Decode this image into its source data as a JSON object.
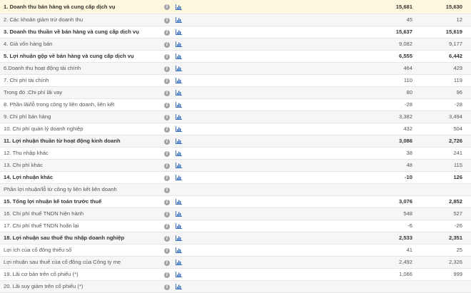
{
  "rows": [
    {
      "label": "1. Doanh thu bán hàng và cung cấp dịch vụ",
      "v1": "15,681",
      "v2": "15,630",
      "bold": true,
      "chart": true
    },
    {
      "label": "2. Các khoản giảm trừ doanh thu",
      "v1": "45",
      "v2": "12",
      "bold": false,
      "chart": true
    },
    {
      "label": "3. Doanh thu thuần về bán hàng và cung cấp dịch vụ",
      "v1": "15,637",
      "v2": "15,619",
      "bold": true,
      "chart": true
    },
    {
      "label": "4. Giá vốn hàng bán",
      "v1": "9,082",
      "v2": "9,177",
      "bold": false,
      "chart": true
    },
    {
      "label": "5. Lợi nhuận gộp về bán hàng và cung cấp dịch vụ",
      "v1": "6,555",
      "v2": "6,442",
      "bold": true,
      "chart": true
    },
    {
      "label": "6.Doanh thu hoạt động tài chính",
      "v1": "464",
      "v2": "429",
      "bold": false,
      "chart": true
    },
    {
      "label": "7. Chi phí tài chính",
      "v1": "110",
      "v2": "119",
      "bold": false,
      "chart": true
    },
    {
      "label": "Trong đó :Chi phí lãi vay",
      "v1": "80",
      "v2": "96",
      "bold": false,
      "chart": true
    },
    {
      "label": "8. Phần lãi/lỗ trong công ty liên doanh, liên kết",
      "v1": "-28",
      "v2": "-28",
      "bold": false,
      "chart": true
    },
    {
      "label": "9. Chi phí bán hàng",
      "v1": "3,382",
      "v2": "3,494",
      "bold": false,
      "chart": true
    },
    {
      "label": "10. Chi phí quản lý doanh nghiệp",
      "v1": "432",
      "v2": "504",
      "bold": false,
      "chart": true
    },
    {
      "label": "11. Lợi nhuận thuần từ hoạt động kinh doanh",
      "v1": "3,086",
      "v2": "2,726",
      "bold": true,
      "chart": true
    },
    {
      "label": "12. Thu nhập khác",
      "v1": "38",
      "v2": "241",
      "bold": false,
      "chart": true
    },
    {
      "label": "13. Chi phí khác",
      "v1": "48",
      "v2": "115",
      "bold": false,
      "chart": true
    },
    {
      "label": "14. Lợi nhuận khác",
      "v1": "-10",
      "v2": "126",
      "bold": true,
      "chart": true
    },
    {
      "label": "Phần lợi nhuận/lỗ từ công ty liên kết liên doanh",
      "v1": "",
      "v2": "",
      "bold": false,
      "chart": false
    },
    {
      "label": "15. Tổng lợi nhuận kế toán trước thuế",
      "v1": "3,076",
      "v2": "2,852",
      "bold": true,
      "chart": true
    },
    {
      "label": "16. Chi phí thuế TNDN hiện hành",
      "v1": "548",
      "v2": "527",
      "bold": false,
      "chart": true
    },
    {
      "label": "17. Chi phí thuế TNDN hoãn lại",
      "v1": "-6",
      "v2": "-26",
      "bold": false,
      "chart": true
    },
    {
      "label": "18. Lợi nhuận sau thuế thu nhập doanh nghiệp",
      "v1": "2,533",
      "v2": "2,351",
      "bold": true,
      "chart": true
    },
    {
      "label": "Lợi ích của cổ đông thiểu số",
      "v1": "41",
      "v2": "25",
      "bold": false,
      "chart": true
    },
    {
      "label": "Lợi nhuận sau thuế của cổ đông của Công ty mẹ",
      "v1": "2,492",
      "v2": "2,326",
      "bold": false,
      "chart": true
    },
    {
      "label": "19. Lãi cơ bản trên cổ phiếu (*)",
      "v1": "1,066",
      "v2": "999",
      "bold": false,
      "chart": true
    },
    {
      "label": "20. Lãi suy giảm trên cổ phiếu (*)",
      "v1": "",
      "v2": "",
      "bold": false,
      "chart": true
    }
  ],
  "icons": {
    "info": "info-circle-icon",
    "chart": "bar-chart-icon"
  },
  "colors": {
    "first_row_bg": "#fdf7dd",
    "chart_icon": "#3a6fbf",
    "info_icon": "#a3a3a3",
    "alt_row_bg": "#f6f6f6"
  }
}
